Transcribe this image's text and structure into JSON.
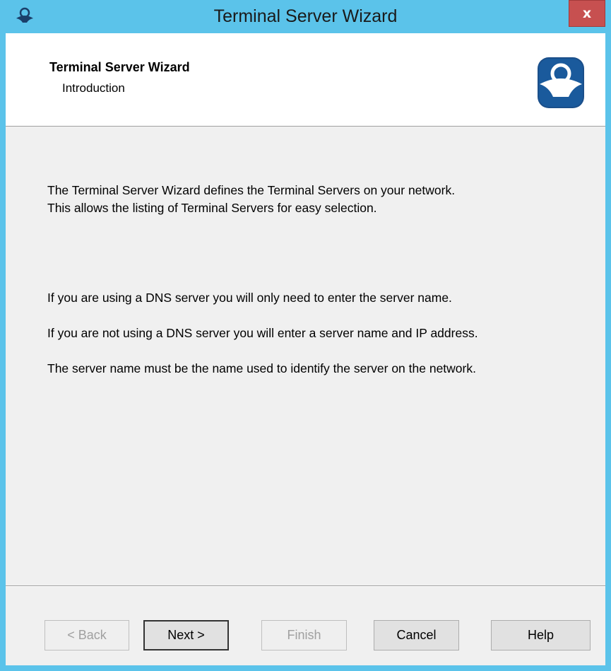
{
  "window": {
    "title": "Terminal Server Wizard",
    "close_label": "x",
    "app_icon": "thinmanager-icon"
  },
  "header": {
    "title": "Terminal Server Wizard",
    "subtitle": "Introduction",
    "logo": "thinmanager-logo"
  },
  "body": {
    "paragraph1_line1": "The Terminal Server Wizard defines the Terminal Servers on your network.",
    "paragraph1_line2": "This allows the listing of Terminal Servers for easy selection.",
    "paragraph2": "If you are using a DNS server you will only need to enter the server name.",
    "paragraph3": "If you are not using a DNS server you will enter a server name and IP address.",
    "paragraph4": "The server name must be the name used to identify the server on the network."
  },
  "buttons": {
    "back": "< Back",
    "next": "Next >",
    "finish": "Finish",
    "cancel": "Cancel",
    "help": "Help"
  },
  "colors": {
    "titlebar": "#5bc3ea",
    "close": "#c75050",
    "logo_blue": "#1b4f8a"
  }
}
